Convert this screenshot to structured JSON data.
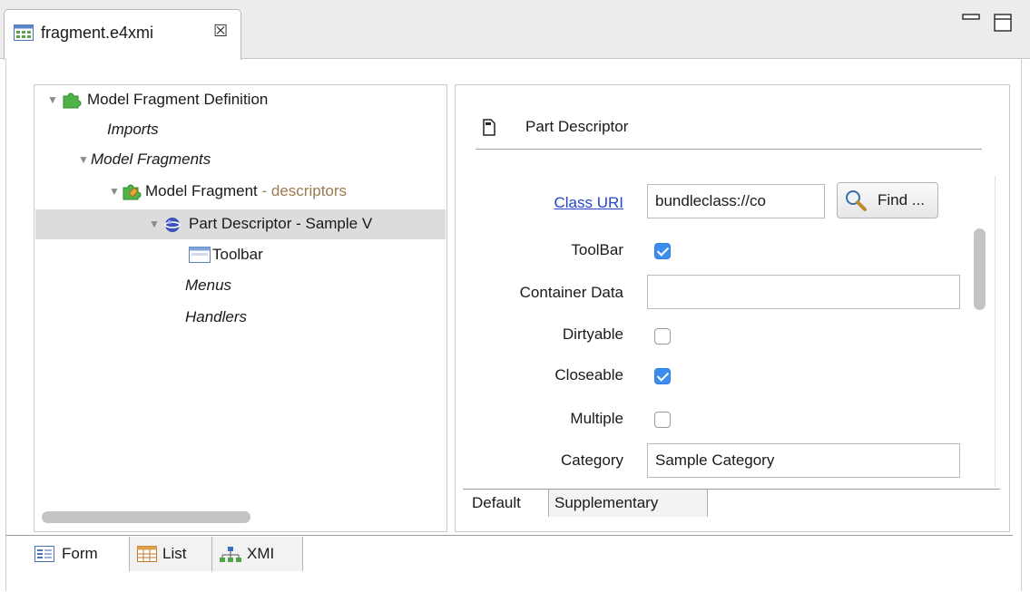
{
  "editor_tab": {
    "title": "fragment.e4xmi",
    "close_glyph": "☒"
  },
  "tree": {
    "nodes": [
      {
        "label": "Model Fragment Definition",
        "suffix": ""
      },
      {
        "label": "Imports",
        "suffix": ""
      },
      {
        "label": "Model Fragments",
        "suffix": ""
      },
      {
        "label": "Model Fragment",
        "suffix": " - descriptors"
      },
      {
        "label": "Part Descriptor",
        "suffix": " - Sample V"
      },
      {
        "label": "Toolbar",
        "suffix": ""
      },
      {
        "label": "Menus",
        "suffix": ""
      },
      {
        "label": "Handlers",
        "suffix": ""
      }
    ]
  },
  "details": {
    "title": "Part Descriptor",
    "class_uri_label": "Class URI",
    "class_uri_value": "bundleclass://co",
    "find_button": "Find ...",
    "toolbar_label": "ToolBar",
    "toolbar_checked": true,
    "container_data_label": "Container Data",
    "container_data_value": "",
    "dirtyable_label": "Dirtyable",
    "dirtyable_checked": false,
    "closeable_label": "Closeable",
    "closeable_checked": true,
    "multiple_label": "Multiple",
    "multiple_checked": false,
    "category_label": "Category",
    "category_value": "Sample Category"
  },
  "detail_tabs": [
    "Default",
    "Supplementary"
  ],
  "bottom_tabs": [
    "Form",
    "List",
    "XMI"
  ],
  "colors": {
    "link": "#2446c9",
    "checkbox_on": "#3b8ef0",
    "suffix_text": "#9a7a50"
  }
}
